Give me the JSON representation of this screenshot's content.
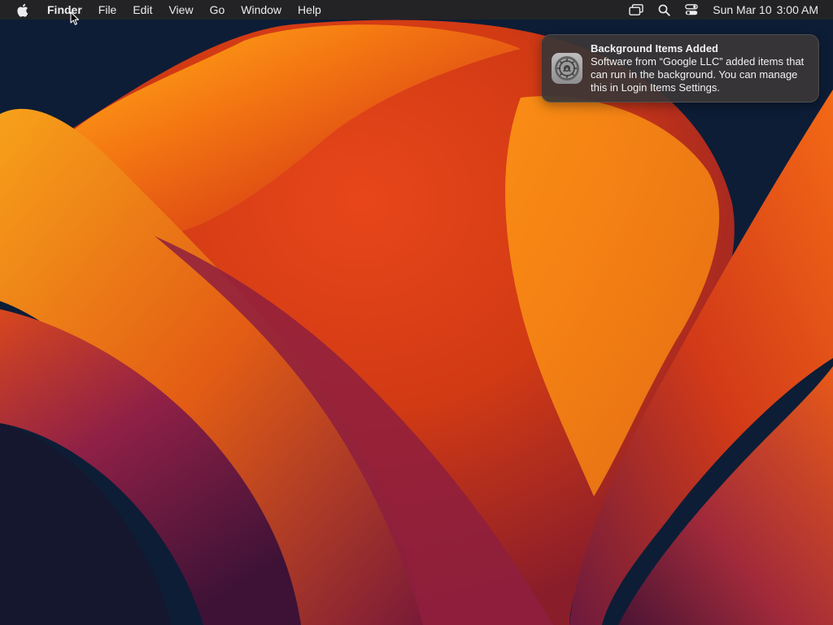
{
  "menubar": {
    "apple_icon": "apple-logo-icon",
    "items": [
      {
        "label": "Finder",
        "bold": true
      },
      {
        "label": "File"
      },
      {
        "label": "Edit"
      },
      {
        "label": "View"
      },
      {
        "label": "Go"
      },
      {
        "label": "Window"
      },
      {
        "label": "Help"
      }
    ],
    "status_icons": [
      "window-overlap-icon",
      "search-icon",
      "control-center-icon"
    ],
    "clock": {
      "date": "Sun Mar 10",
      "time": "3:00 AM"
    }
  },
  "notification": {
    "icon": "system-settings-gear-icon",
    "title": "Background Items Added",
    "body": "Software from “Google LLC” added items that can run in the background. You can manage this in Login Items Settings."
  },
  "colors": {
    "menubar_bg": "#232326",
    "notification_bg": "#3a3636",
    "wallpaper_dark": "#0d1d36",
    "wallpaper_orange": "#f57a12",
    "wallpaper_purple": "#6b1a48"
  }
}
